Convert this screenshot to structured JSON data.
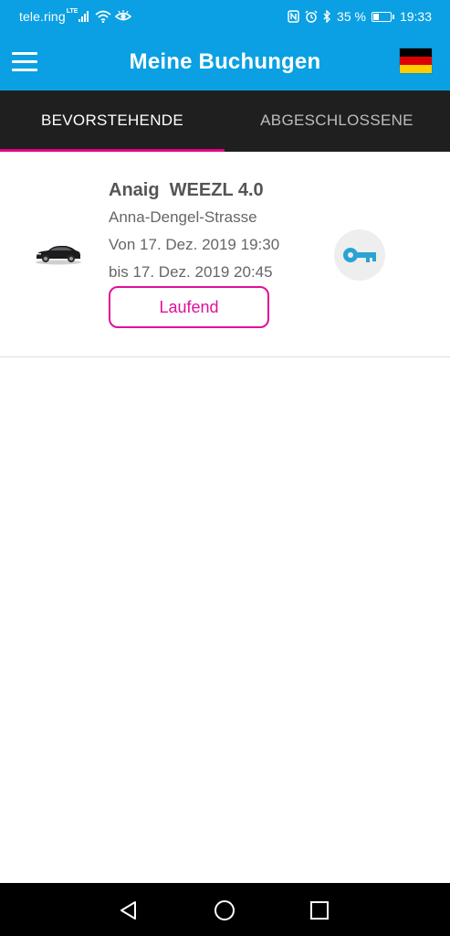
{
  "status_bar": {
    "carrier": "tele.ring",
    "network": "LTE",
    "battery_percent": "35 %",
    "battery_level": 0.35,
    "time": "19:33",
    "icons": [
      "signal-icon",
      "wifi-icon",
      "eye-icon",
      "nfc-icon",
      "alarm-icon",
      "bluetooth-icon",
      "battery-icon"
    ]
  },
  "app_bar": {
    "title": "Meine Buchungen",
    "menu_icon": "hamburger-menu-icon",
    "language_icon": "german-flag-icon",
    "flag_colors": [
      "#000000",
      "#dd0000",
      "#ffce00"
    ]
  },
  "tabs": [
    {
      "label": "BEVORSTEHENDE",
      "active": true
    },
    {
      "label": "ABGESCHLOSSENE",
      "active": false
    }
  ],
  "bookings": [
    {
      "title": "Anaig  WEEZL 4.0",
      "address": "Anna-Dengel-Strasse",
      "from": "Von 17. Dez. 2019 19:30",
      "until": "bis 17. Dez. 2019 20:45",
      "status": "Laufend",
      "vehicle_icon": "car-icon",
      "action_icon": "key-icon"
    }
  ],
  "colors": {
    "primary": "#0aa0e3",
    "tab_bar": "#1f1f1f",
    "accent": "#e6007e",
    "key_icon": "#2aa3d3"
  },
  "nav_bar": {
    "icons": [
      "back-icon",
      "home-icon",
      "recent-apps-icon"
    ]
  }
}
